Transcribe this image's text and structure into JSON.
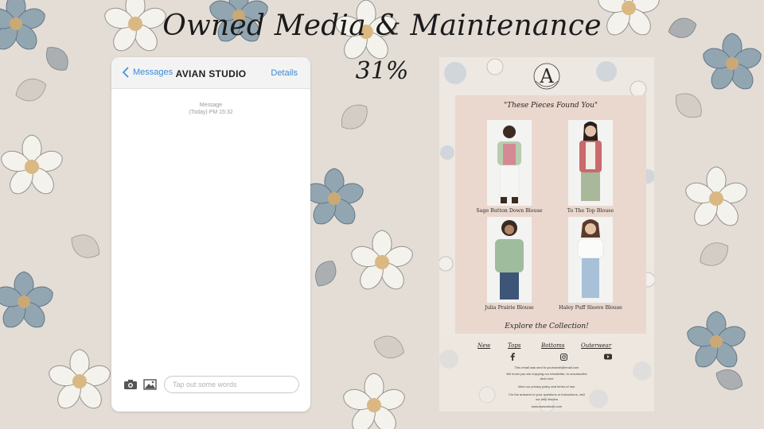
{
  "slide": {
    "title": "Owned Media & Maintenance",
    "progress": "31%"
  },
  "messages": {
    "back_label": "Messages",
    "contact": "AVIAN STUDIO",
    "details_label": "Details",
    "meta_label": "Message",
    "meta_time": "(Today) PM 15:32",
    "composer_placeholder": "Tap out some words"
  },
  "email": {
    "logo_letter": "A",
    "headline": "\"These Pieces Found You\"",
    "products": [
      {
        "name": "Sage Button Down Blouse"
      },
      {
        "name": "To The Top Blouse"
      },
      {
        "name": "Julia Prairie Blouse"
      },
      {
        "name": "Haley Puff Sleeve Blouse"
      }
    ],
    "cta": "Explore the Collection!",
    "nav": [
      "New",
      "Tops",
      "Bottoms",
      "Outerwear"
    ],
    "footer": [
      "This email was sent to yourname@email.com",
      "We know you are enjoying our newsletter; to unsubscribe",
      "click here",
      "View our privacy policy and terms of use.",
      "For the answers to your questions or instructions, visit",
      "our help section",
      "www.avianstudio.com"
    ]
  },
  "colors": {
    "link_blue": "#3b8bd8",
    "panel_blush": "#ead8cf"
  }
}
